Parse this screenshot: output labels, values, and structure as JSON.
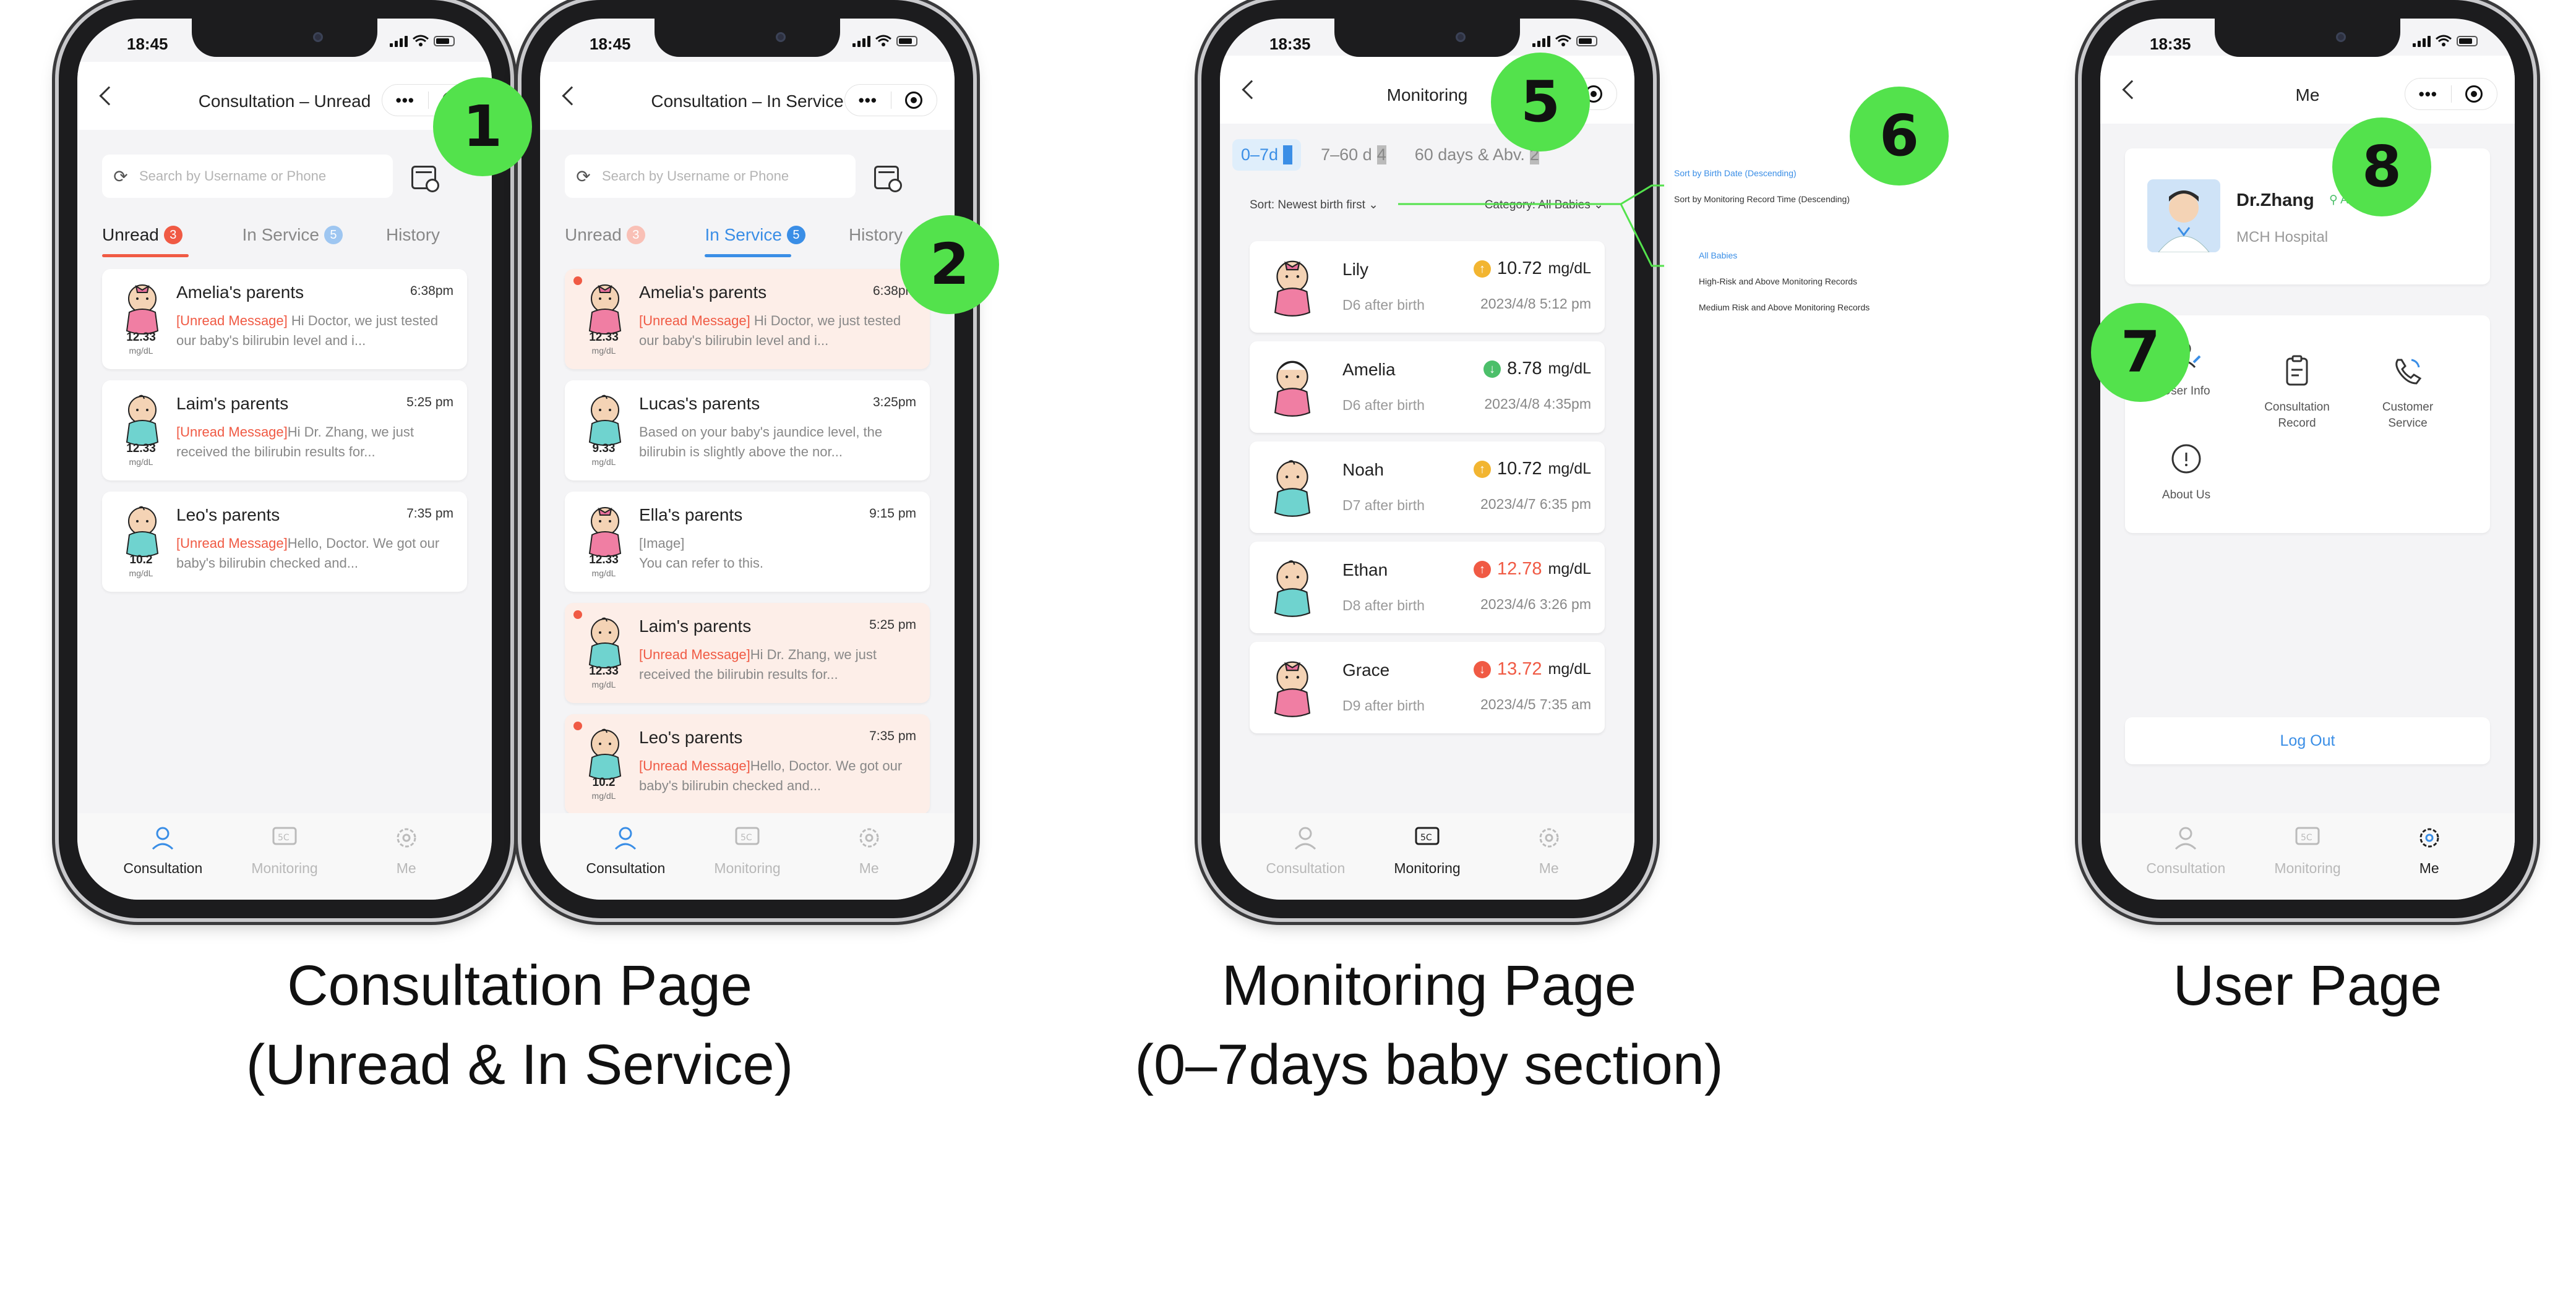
{
  "status_time_a": "18:45",
  "status_time_b": "18:35",
  "capsule_dots": "•••",
  "consult_unread": {
    "title": "Consultation – Unread",
    "search_placeholder": "Search by Username or Phone",
    "tabs": [
      {
        "label": "Unread",
        "count": "3"
      },
      {
        "label": "In Service",
        "count": "5"
      },
      {
        "label": "History",
        "count": ""
      }
    ],
    "messages": [
      {
        "name": "Amelia's parents",
        "time": "6:38pm",
        "value": "12.33",
        "unit": "mg/dL",
        "tag": "[Unread Message]",
        "text": " Hi Doctor, we just tested our baby's bilirubin level and i..."
      },
      {
        "name": "Laim's parents",
        "time": "5:25 pm",
        "value": "12.33",
        "unit": "mg/dL",
        "tag": "[Unread Message]",
        "text": "Hi Dr. Zhang, we just received the bilirubin results for..."
      },
      {
        "name": "Leo's parents",
        "time": "7:35 pm",
        "value": "10.2",
        "unit": "mg/dL",
        "tag": "[Unread Message]",
        "text": "Hello, Doctor. We got our baby's bilirubin checked and..."
      }
    ]
  },
  "consult_service": {
    "title": "Consultation – In Service",
    "search_placeholder": "Search by Username or Phone",
    "tabs": [
      {
        "label": "Unread",
        "count": "3"
      },
      {
        "label": "In Service",
        "count": "5"
      },
      {
        "label": "History",
        "count": ""
      }
    ],
    "messages": [
      {
        "name": "Amelia's parents",
        "time": "6:38pm",
        "value": "12.33",
        "unit": "mg/dL",
        "tag": "[Unread Message]",
        "text": " Hi Doctor, we just tested our baby's bilirubin level and i..."
      },
      {
        "name": "Lucas's parents",
        "time": "3:25pm",
        "value": "9.33",
        "unit": "mg/dL",
        "tag": "",
        "text": "Based on your baby's jaundice level, the bilirubin is slightly above the nor..."
      },
      {
        "name": "Ella's parents",
        "time": "9:15 pm",
        "value": "12.33",
        "unit": "mg/dL",
        "tag": "",
        "text": "[Image]\n You can refer to this."
      },
      {
        "name": "Laim's parents",
        "time": "5:25 pm",
        "value": "12.33",
        "unit": "mg/dL",
        "tag": "[Unread Message]",
        "text": "Hi Dr. Zhang, we just received the bilirubin results for..."
      },
      {
        "name": "Leo's parents",
        "time": "7:35 pm",
        "value": "10.2",
        "unit": "mg/dL",
        "tag": "[Unread Message]",
        "text": "Hello, Doctor. We got our baby's bilirubin checked and..."
      }
    ]
  },
  "tabbar": {
    "consultation": "Consultation",
    "monitoring": "Monitoring",
    "me": "Me"
  },
  "monitoring": {
    "title": "Monitoring",
    "age_tabs": [
      {
        "label": "0–7d",
        "count": "5"
      },
      {
        "label": "7–60 d",
        "count": "4"
      },
      {
        "label": "60 days & Abv.",
        "count": "2"
      }
    ],
    "sort_label": "Sort: Newest birth first",
    "category_label": "Category: All Babies",
    "sort_options": [
      "Sort by Birth Date (Descending)",
      "Sort by Monitoring Record Time (Descending)"
    ],
    "category_options": [
      "All Babies",
      "High-Risk and Above Monitoring Records",
      "Medium Risk and Above Monitoring Records"
    ],
    "babies": [
      {
        "name": "Lily",
        "age": "D6 after birth",
        "value": "10.72",
        "unit": "mg/dL",
        "date": "2023/4/8 5:12 pm",
        "trend": "up",
        "trend_color": "#f2b531",
        "value_color": "#222222"
      },
      {
        "name": "Amelia",
        "age": "D6 after birth",
        "value": "8.78",
        "unit": "mg/dL",
        "date": "2023/4/8 4:35pm",
        "trend": "down",
        "trend_color": "#4cbf6a",
        "value_color": "#222222"
      },
      {
        "name": "Noah",
        "age": "D7 after birth",
        "value": "10.72",
        "unit": "mg/dL",
        "date": "2023/4/7 6:35 pm",
        "trend": "up",
        "trend_color": "#f2b531",
        "value_color": "#222222"
      },
      {
        "name": "Ethan",
        "age": "D8 after birth",
        "value": "12.78",
        "unit": "mg/dL",
        "date": "2023/4/6 3:26 pm",
        "trend": "up",
        "trend_color": "#f05a44",
        "value_color": "#f05a44"
      },
      {
        "name": "Grace",
        "age": "D9 after birth",
        "value": "13.72",
        "unit": "mg/dL",
        "date": "2023/4/5 7:35 am",
        "trend": "down",
        "trend_color": "#f05a44",
        "value_color": "#f05a44"
      }
    ]
  },
  "me": {
    "title": "Me",
    "doctor_name": "Dr.Zhang",
    "availability": "Available",
    "hospital": "MCH Hospital",
    "services": [
      {
        "label": "User Info",
        "icon": "user-edit-icon"
      },
      {
        "label": "Consultation\nRecord",
        "icon": "clipboard-icon"
      },
      {
        "label": "Customer\nService",
        "icon": "phone-icon"
      },
      {
        "label": "About Us",
        "icon": "info-icon"
      }
    ],
    "logout": "Log Out"
  },
  "markers": [
    "1",
    "2",
    "5",
    "6",
    "7",
    "8"
  ],
  "captions": {
    "consultation_line1": "Consultation Page",
    "consultation_line2": "(Unread & In Service)",
    "monitoring_line1": "Monitoring Page",
    "monitoring_line2": "(0–7days baby section)",
    "user": "User Page"
  },
  "colors": {
    "accent_blue": "#3a8ee6",
    "alert_red": "#f05a44",
    "marker_green": "#53e24c",
    "unread_bg": "#fdeee8"
  }
}
